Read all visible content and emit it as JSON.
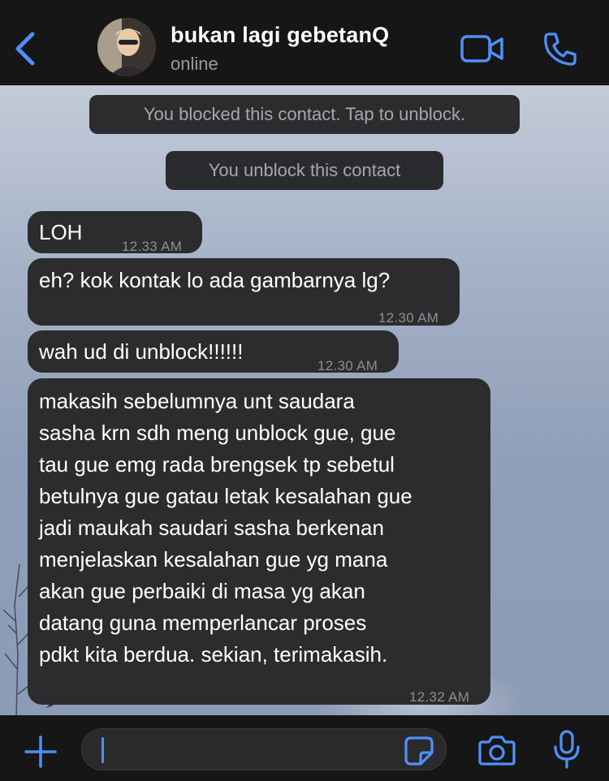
{
  "header": {
    "contact_name": "bukan lagi gebetanQ",
    "status": "online",
    "icons": [
      "back-chevron-icon",
      "video-camera-icon",
      "phone-icon"
    ]
  },
  "system_messages": [
    "You blocked this contact. Tap to unblock.",
    "You unblock this contact"
  ],
  "messages": [
    {
      "text": "LOH",
      "time": "12.33 AM"
    },
    {
      "text": "eh? kok kontak lo ada gambarnya lg?",
      "time": "12.30 AM"
    },
    {
      "text": "wah ud di unblock!!!!!!",
      "time": "12.30 AM"
    },
    {
      "text": "makasih sebelumnya unt saudara\nsasha krn sdh meng unblock gue, gue\ntau gue emg rada brengsek tp sebetul\nbetulnya gue gatau letak kesalahan gue\njadi maukah saudari sasha berkenan\nmenjelaskan kesalahan gue yg mana\nakan gue perbaiki di masa yg akan\ndatang guna memperlancar proses\npdkt kita berdua. sekian, terimakasih.",
      "time": "12.32 AM"
    }
  ],
  "composer": {
    "value": "",
    "icons": [
      "plus-icon",
      "sticker-icon",
      "camera-icon",
      "microphone-icon"
    ]
  },
  "colors": {
    "accent": "#4f8ff7",
    "bubble": "#2c2c2e",
    "bar": "#161616"
  }
}
